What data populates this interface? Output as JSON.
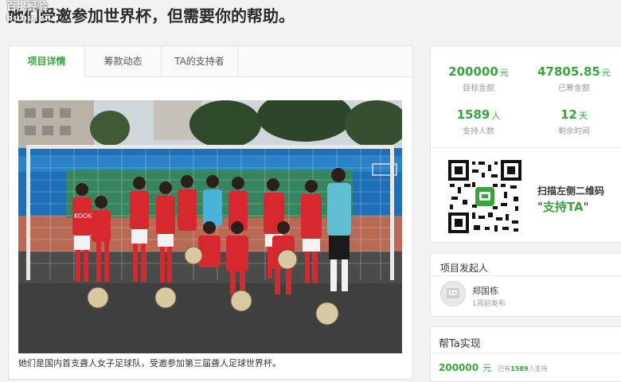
{
  "watermark": {
    "line1": "百度经验",
    "line2": "bubu.cn"
  },
  "page": {
    "title": "她们受邀参加世界杯，但需要你的帮助。"
  },
  "tabs": [
    {
      "label": "项目详情",
      "active": true
    },
    {
      "label": "筹款动态",
      "active": false
    },
    {
      "label": "TA的支持者",
      "active": false
    }
  ],
  "photo": {
    "caption": "她们是国内首支聋人女子足球队，受邀参加第三届聋人足球世界杯。",
    "jersey_text": "KOOK"
  },
  "stats": {
    "target": {
      "value": "200000",
      "unit": "元",
      "label": "目标金额"
    },
    "raised": {
      "value": "47805.85",
      "unit": "元",
      "label": "已筹金额"
    },
    "supporters": {
      "value": "1589",
      "unit": "人",
      "label": "支持人数"
    },
    "remaining": {
      "value": "12",
      "unit": "天",
      "label": "剩余时间"
    }
  },
  "qr": {
    "scan_text": "扫描左侧二维码",
    "support_label": "支持TA",
    "quote_open": "\"",
    "quote_close": "\""
  },
  "sponsor": {
    "title": "项目发起人",
    "name": "郑国栋",
    "time": "1周前发布"
  },
  "help": {
    "title": "帮Ta实现",
    "amount": "200000",
    "unit": "元",
    "prefix": "已有",
    "count": "1589",
    "suffix": "人支持"
  },
  "colors": {
    "accent": "#3aa33e",
    "jersey": "#d8282f",
    "pitch_blue": "#1d6fb8"
  }
}
